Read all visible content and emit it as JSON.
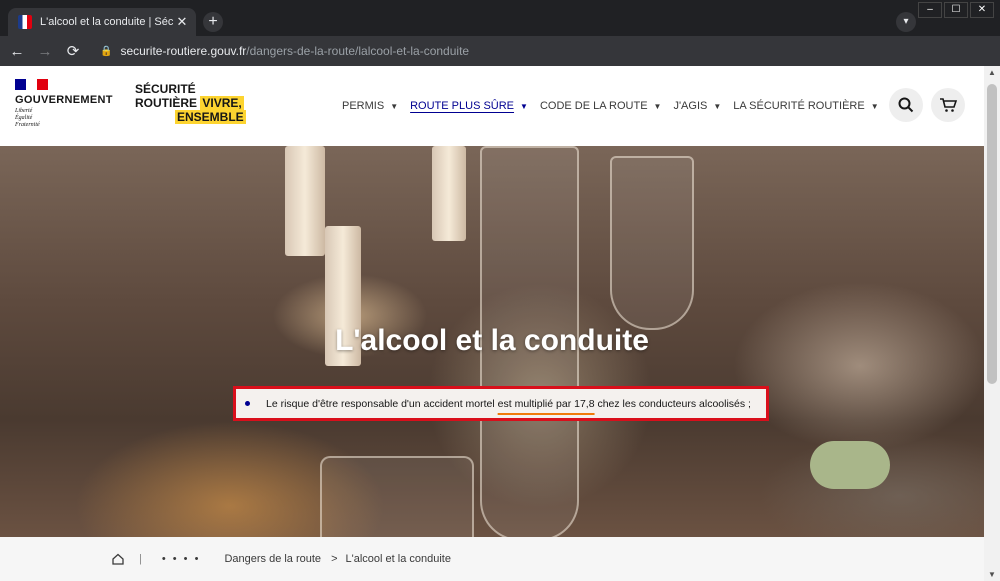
{
  "browser": {
    "tab_title": "L'alcool et la conduite | Sécurité R",
    "tab_close": "✕",
    "new_tab": "+",
    "url_domain": "securite-routiere.gouv.fr",
    "url_path": "/dangers-de-la-route/lalcool-et-la-conduite",
    "window_controls": [
      "–",
      "☐",
      "✕"
    ]
  },
  "header": {
    "gov_name": "GOUVERNEMENT",
    "gov_motto": [
      "Liberté",
      "Égalité",
      "Fraternité"
    ],
    "brand_line1": "SÉCURITÉ",
    "brand_line2": "ROUTIÈRE",
    "brand_highlight1": "VIVRE,",
    "brand_highlight2": "ENSEMBLE",
    "menu": [
      {
        "label": "PERMIS"
      },
      {
        "label": "ROUTE PLUS SÛRE",
        "active": true
      },
      {
        "label": "CODE DE LA ROUTE"
      },
      {
        "label": "J'AGIS"
      },
      {
        "label": "LA SÉCURITÉ ROUTIÈRE"
      }
    ]
  },
  "hero": {
    "title": "L'alcool et la conduite",
    "statement_before": "Le risque d'être responsable d'un accident mortel ",
    "statement_highlight": "est multiplié par 17,8",
    "statement_after": " chez les conducteurs alcoolisés ;"
  },
  "breadcrumb": {
    "ellipsis": "• • • •",
    "section": "Dangers de la route",
    "separator": ">",
    "current": "L'alcool et la conduite"
  },
  "icons": {
    "search": "search-icon",
    "cart": "cart-icon",
    "home": "home-icon"
  },
  "colors": {
    "accent_blue": "#000091",
    "highlight_yellow": "#fdd430",
    "annotation_red": "#d90f1b",
    "annotation_orange": "#f07a0a"
  }
}
